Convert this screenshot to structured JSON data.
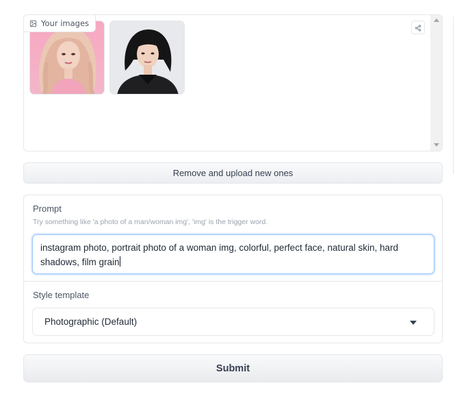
{
  "gallery": {
    "label": "Your images",
    "images": [
      {
        "alt": "woman-pink-hair-portrait"
      },
      {
        "alt": "woman-black-bob-portrait"
      }
    ]
  },
  "remove_button": {
    "label": "Remove and upload new ones"
  },
  "prompt": {
    "label": "Prompt",
    "info": "Try something like 'a photo of a man/woman img', 'img' is the trigger word.",
    "value": "instagram photo, portrait photo of a woman img, colorful, perfect face, natural skin, hard shadows, film grain"
  },
  "style": {
    "label": "Style template",
    "selected": "Photographic (Default)"
  },
  "submit_button": {
    "label": "Submit"
  },
  "colors": {
    "focus_border": "#93c5fd",
    "border": "#e5e7eb"
  }
}
